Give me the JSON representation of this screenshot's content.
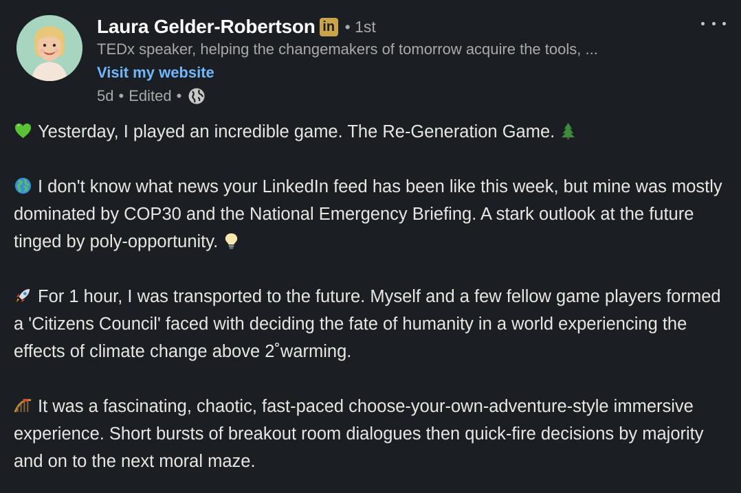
{
  "author": {
    "name": "Laura Gelder-Robertson",
    "badge": "in",
    "connection_degree": "1st",
    "headline": "TEDx speaker, helping the changemakers of tomorrow acquire the tools, ...",
    "website_link": "Visit my website",
    "post_age": "5d",
    "edited_label": "Edited",
    "visibility_icon": "globe-icon"
  },
  "colors": {
    "background": "#1b1f23",
    "link": "#71b7fb",
    "muted": "#a9a9a9",
    "badge": "#c9a24a"
  },
  "post": {
    "paragraphs": [
      {
        "emoji": "green-heart",
        "text": "Yesterday, I played an incredible game. The Re-Generation Game.",
        "trailing_emoji": "evergreen-tree"
      },
      {
        "emoji": "globe-earth",
        "text": "I don't know what news your LinkedIn feed has been like this week, but mine was mostly dominated by COP30 and the National Emergency Briefing. A stark outlook at the future tinged by poly-opportunity.",
        "trailing_emoji": "light-bulb"
      },
      {
        "emoji": "rocket",
        "text": "For 1 hour, I was transported to the future. Myself and a few fellow game players formed a 'Citizens Council' faced with deciding the fate of humanity in a world experiencing the effects of climate change above 2˚warming."
      },
      {
        "emoji": "roller-coaster",
        "text": "It was a fascinating, chaotic, fast-paced choose-your-own-adventure-style immersive experience. Short bursts of breakout room dialogues then quick-fire decisions by majority and on to the next moral maze."
      }
    ]
  }
}
